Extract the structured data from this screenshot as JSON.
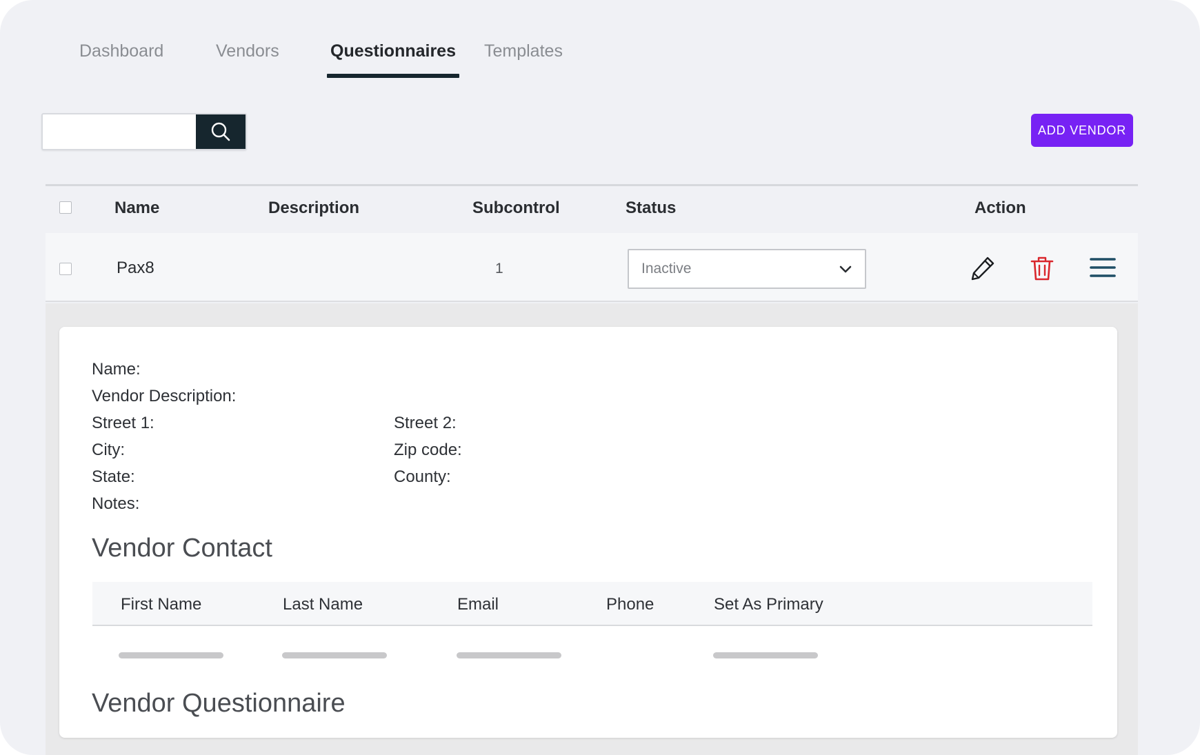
{
  "tabs": [
    {
      "label": "Dashboard",
      "active": false
    },
    {
      "label": "Vendors",
      "active": false
    },
    {
      "label": "Questionnaires",
      "active": true
    },
    {
      "label": "Templates",
      "active": false
    }
  ],
  "search": {
    "placeholder": "",
    "value": "",
    "icon": "search-icon"
  },
  "toolbar": {
    "add_vendor_label": "ADD VENDOR",
    "accent": "#7722f4"
  },
  "table": {
    "headers": {
      "name": "Name",
      "description": "Description",
      "subcontrol": "Subcontrol",
      "status": "Status",
      "action": "Action"
    },
    "rows": [
      {
        "name": "Pax8",
        "description": "",
        "subcontrol": "1",
        "status": "Inactive",
        "actions": [
          "pencil-icon",
          "trash-icon",
          "menu-icon"
        ]
      }
    ]
  },
  "details": {
    "name_label": "Name:",
    "vendor_description_label": "Vendor Description:",
    "street1_label": "Street 1:",
    "street2_label": "Street 2:",
    "city_label": "City:",
    "zip_label": "Zip code:",
    "state_label": "State:",
    "county_label": "County:",
    "notes_label": "Notes:"
  },
  "vendor_contact": {
    "title": "Vendor Contact",
    "headers": {
      "first_name": "First Name",
      "last_name": "Last Name",
      "email": "Email",
      "phone": "Phone",
      "set_as_primary": "Set As Primary"
    }
  },
  "vendor_questionnaire": {
    "title": "Vendor Questionnaire"
  },
  "colors": {
    "dark": "#16262e",
    "danger": "#d9262c",
    "menu": "#1f4e66"
  }
}
